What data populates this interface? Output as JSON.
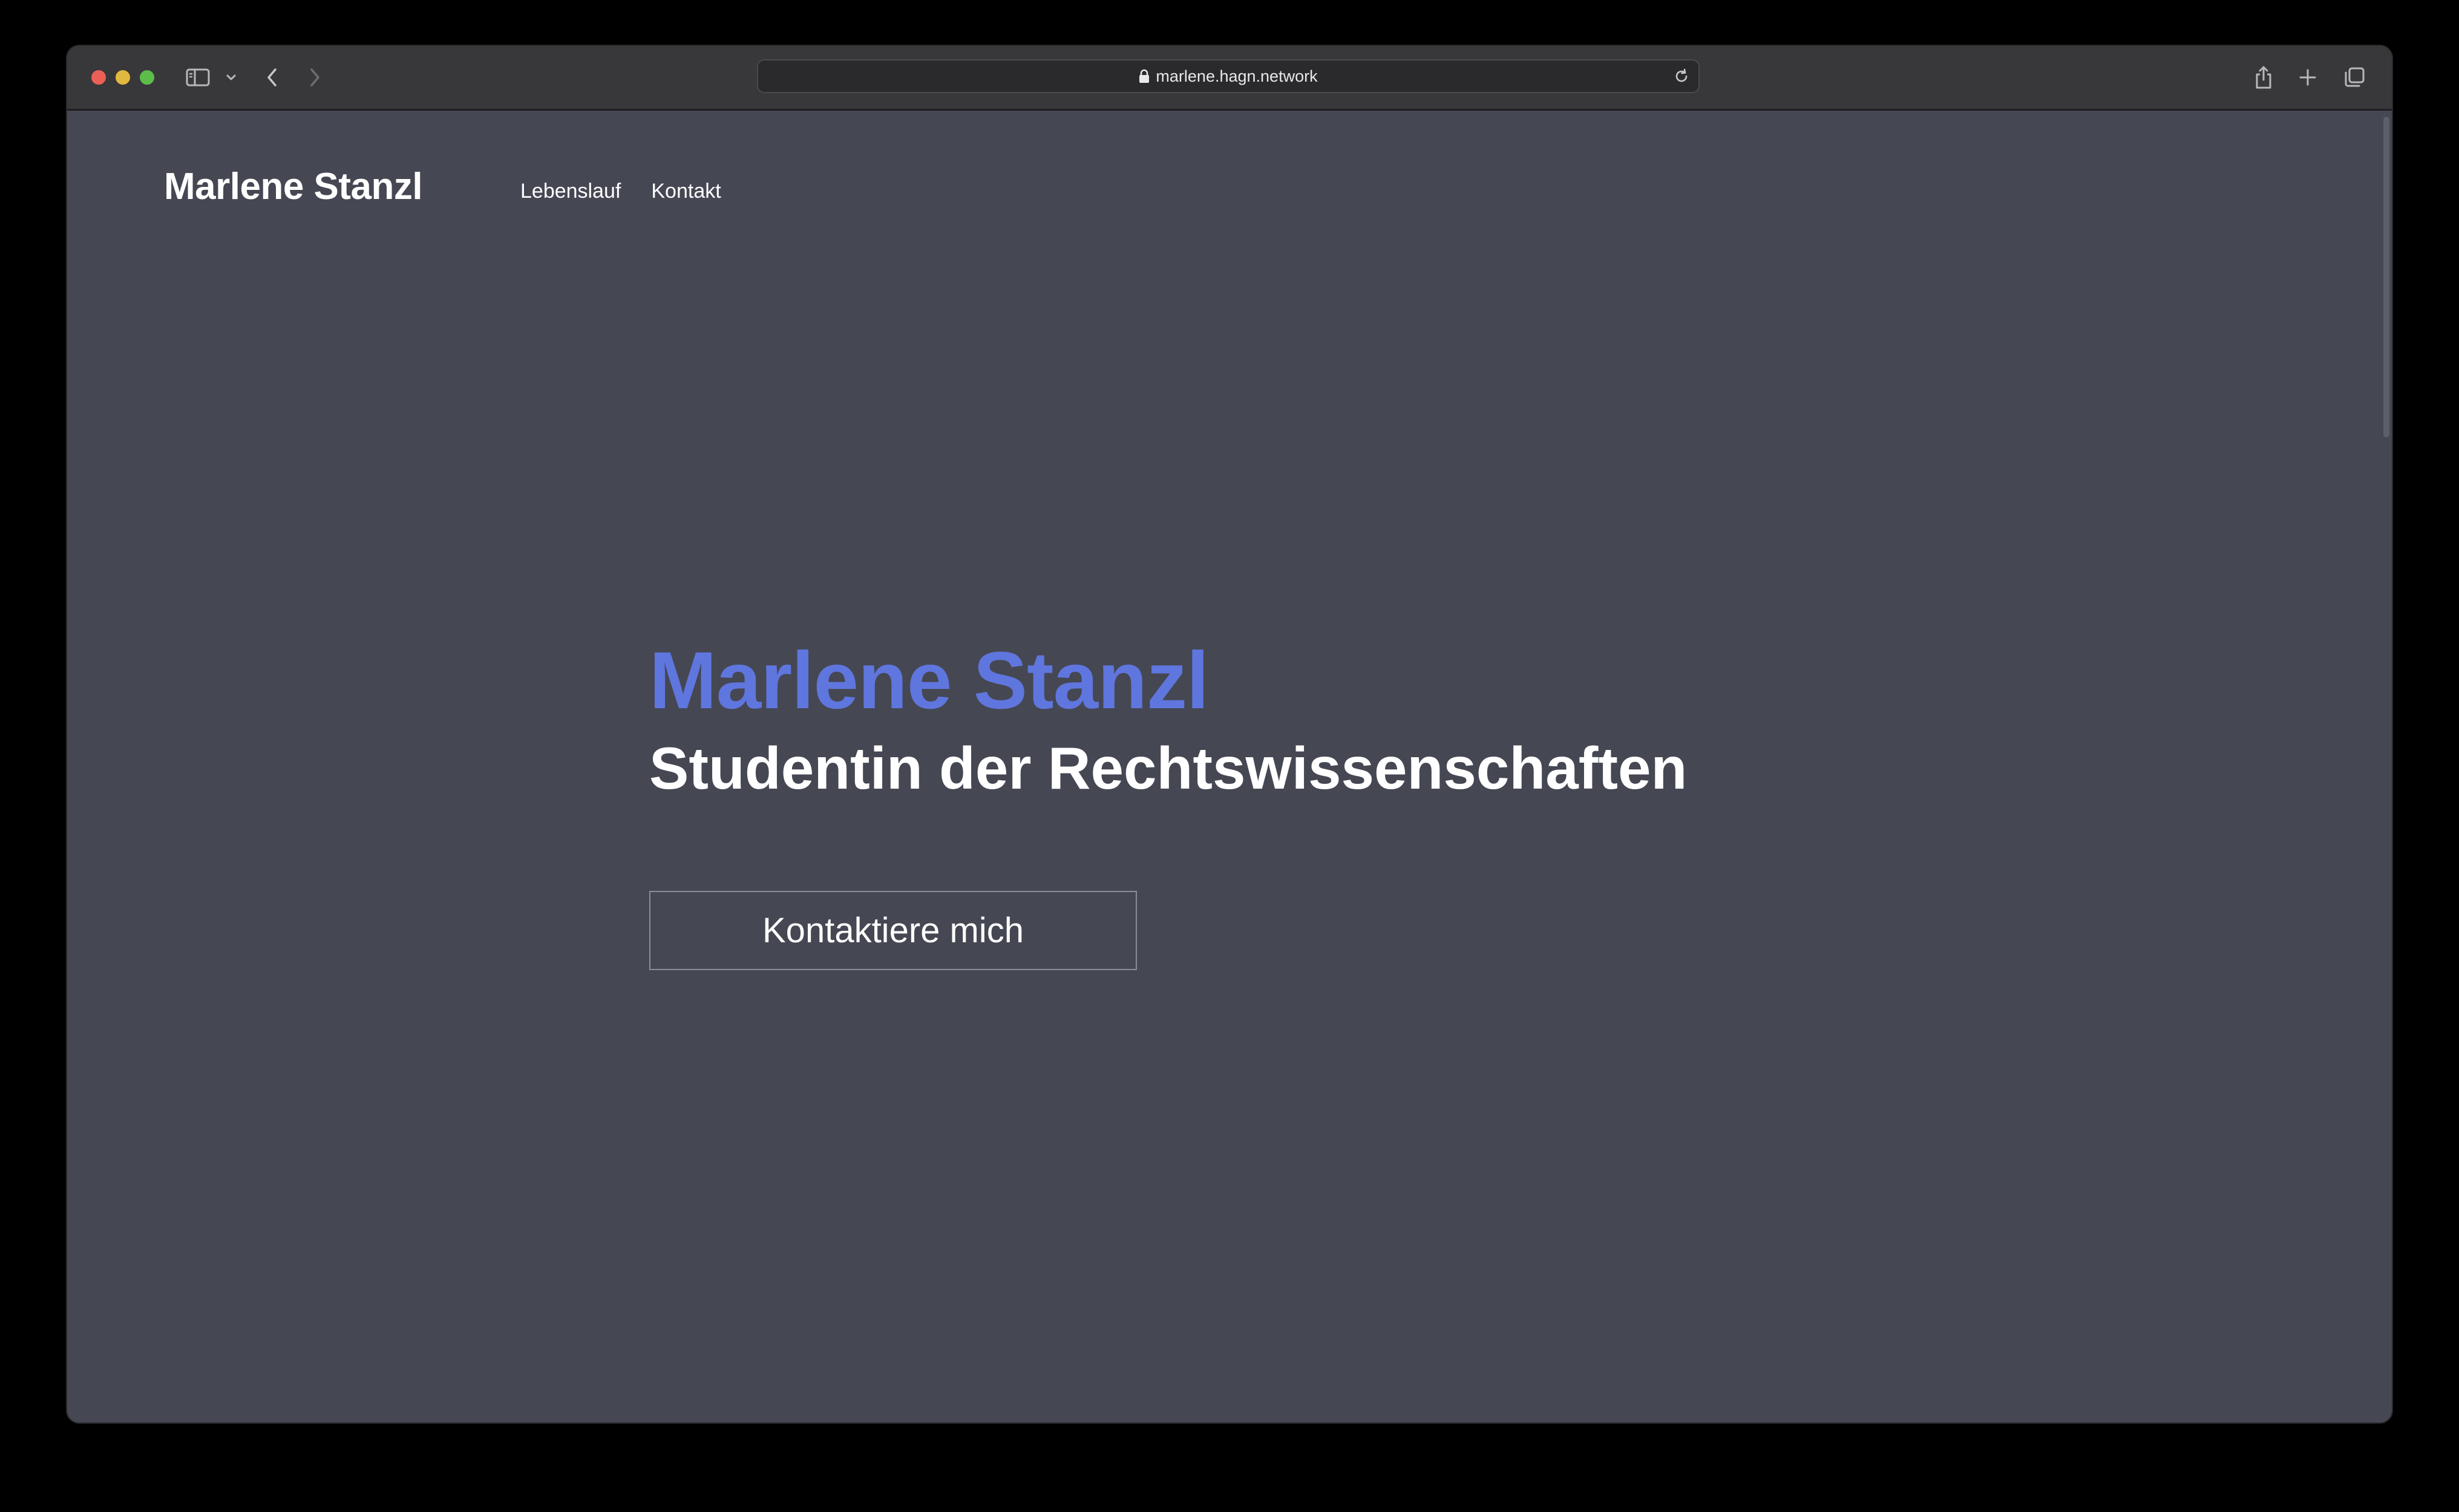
{
  "browser": {
    "url": "marlene.hagn.network",
    "icons": {
      "sidebar": "sidebar-icon",
      "chevron": "chevron-down-icon",
      "back": "back-arrow-icon",
      "forward": "forward-arrow-icon",
      "lock": "lock-icon",
      "reload": "reload-icon",
      "share": "share-icon",
      "new_tab": "plus-icon",
      "tabs": "tab-overview-icon"
    },
    "traffic_colors": [
      "#ec5f57",
      "#e1b93f",
      "#5cbd4a"
    ]
  },
  "site": {
    "brand": "Marlene Stanzl",
    "nav": [
      {
        "label": "Lebenslauf"
      },
      {
        "label": "Kontakt"
      }
    ],
    "hero": {
      "name": "Marlene Stanzl",
      "subtitle": "Studentin der Rechtswissenschaften",
      "cta_label": "Kontaktiere mich"
    },
    "colors": {
      "background": "#454753",
      "accent": "#5f76de",
      "text": "#ffffff"
    }
  }
}
